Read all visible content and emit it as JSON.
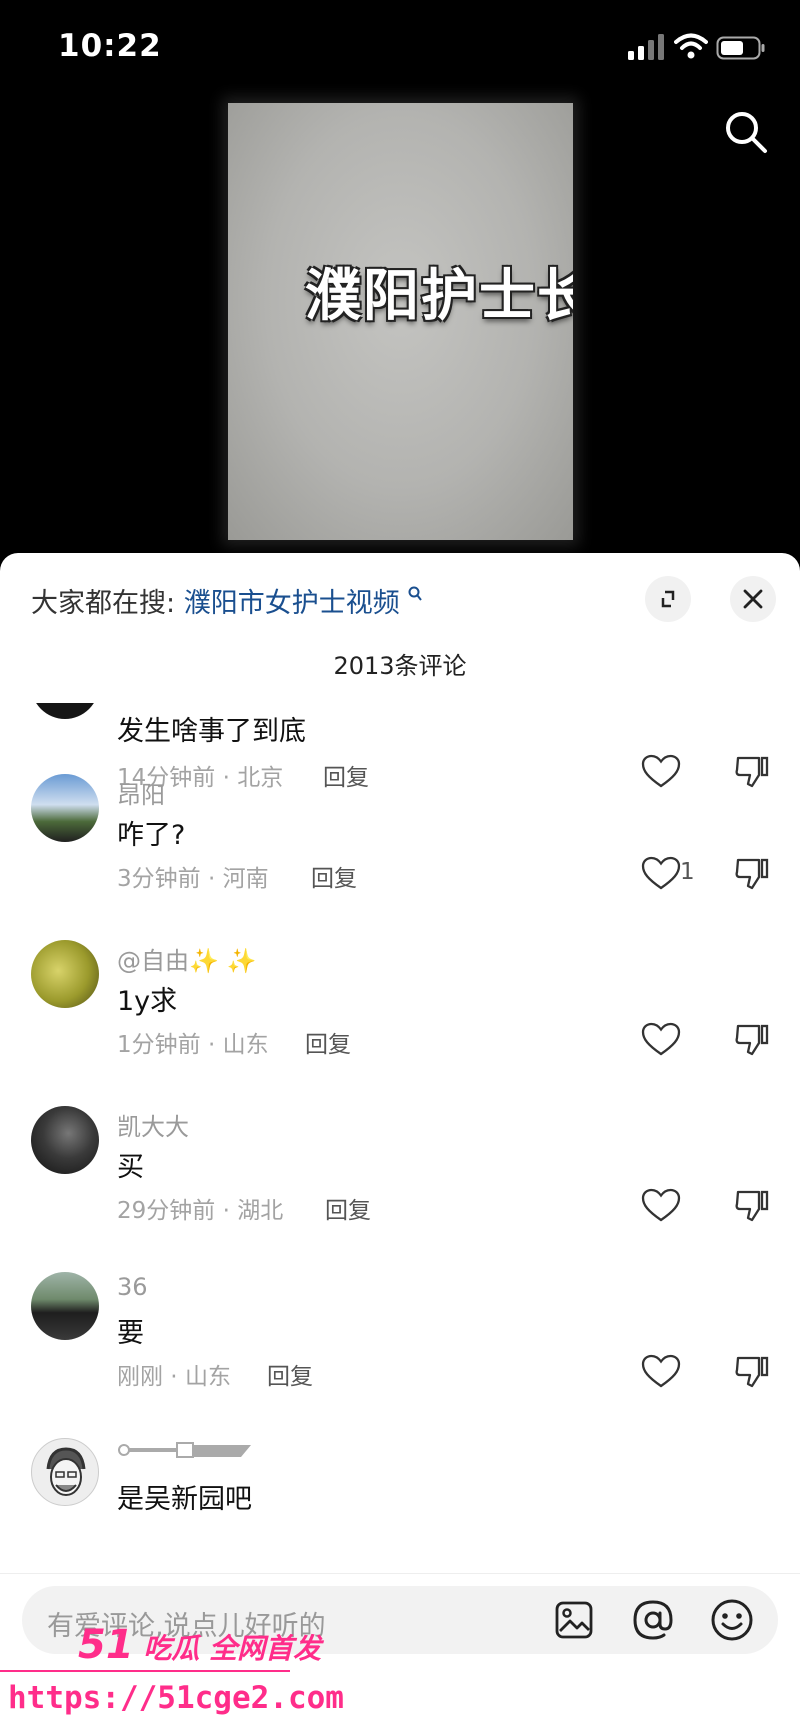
{
  "status_bar": {
    "time": "10:22"
  },
  "video": {
    "overlay_text": "濮阳护士长"
  },
  "comments_panel": {
    "hot_search_prefix": "大家都在搜:",
    "hot_search_keyword": "濮阳市女护士视频",
    "comment_count": "2013条评论",
    "reply_label": "回复",
    "comments": [
      {
        "user": "",
        "text": "发生啥事了到底",
        "time": "14分钟前",
        "location": "北京",
        "likes": ""
      },
      {
        "user": "昂阳",
        "text": "咋了?",
        "time": "3分钟前",
        "location": "河南",
        "likes": "1"
      },
      {
        "user": "@自由✨ ✨",
        "text": "1y求",
        "time": "1分钟前",
        "location": "山东",
        "likes": ""
      },
      {
        "user": "凯大大",
        "text": "买",
        "time": "29分钟前",
        "location": "湖北",
        "likes": ""
      },
      {
        "user": "36",
        "text": "要",
        "time": "刚刚",
        "location": "山东",
        "likes": ""
      },
      {
        "user": "",
        "text": "是吴新园吧",
        "time": "",
        "location": "",
        "likes": ""
      }
    ]
  },
  "comment_input": {
    "placeholder": "有爱评论,说点儿好听的"
  },
  "watermark": {
    "brand_number": "51",
    "brand_text": "吃瓜 全网首发",
    "url": "https://51cge2.com"
  },
  "colors": {
    "link": "#1a4f8f",
    "watermark": "#ff2d8a"
  }
}
